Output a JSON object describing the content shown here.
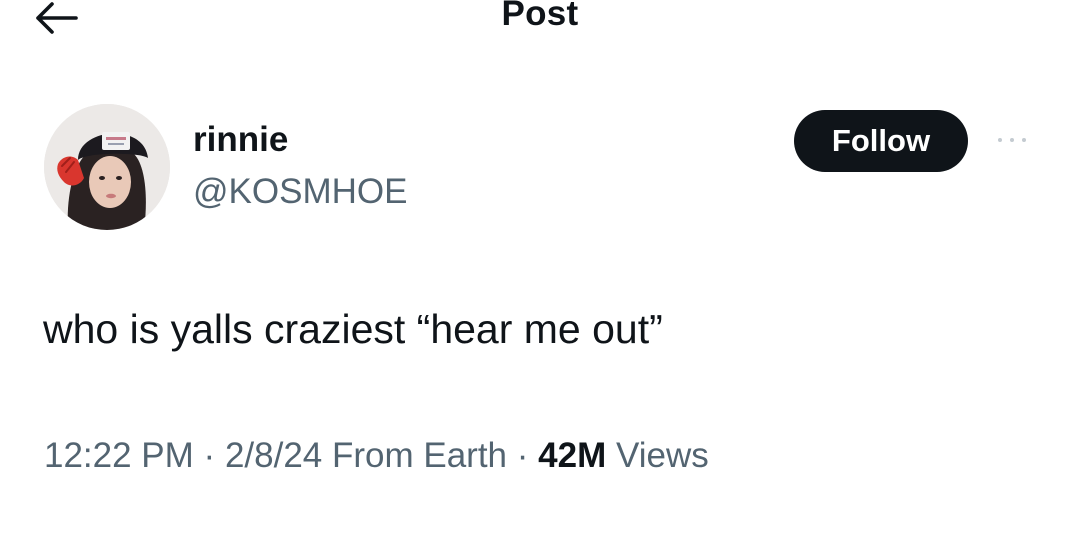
{
  "header": {
    "title": "Post",
    "back_icon": "arrow-left-icon"
  },
  "author": {
    "display_name": "rinnie",
    "handle": "@KOSMHOE",
    "avatar": "profile-photo"
  },
  "actions": {
    "follow_label": "Follow",
    "more_icon": "more-dots-icon"
  },
  "post": {
    "text": "who is yalls craziest “hear me out”"
  },
  "meta": {
    "time": "12:22 PM",
    "separator": "·",
    "date": "2/8/24",
    "source": "From Earth",
    "views_count": "42M",
    "views_label": "Views"
  },
  "colors": {
    "text_primary": "#0f1419",
    "text_secondary": "#536471",
    "follow_bg": "#0f1419",
    "background": "#ffffff"
  }
}
